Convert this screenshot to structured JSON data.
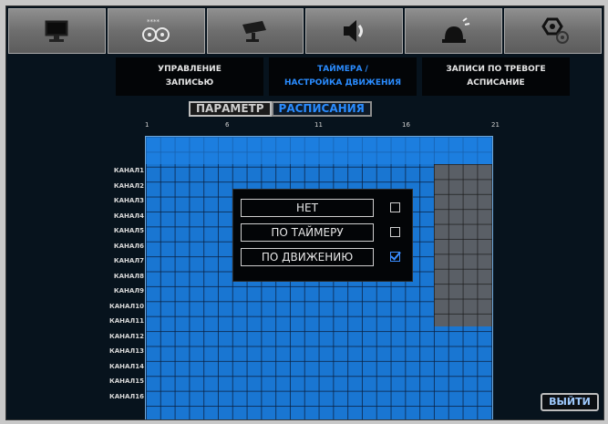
{
  "top_icons": [
    {
      "name": "monitor-icon"
    },
    {
      "name": "record-icon"
    },
    {
      "name": "camera-icon"
    },
    {
      "name": "speaker-icon"
    },
    {
      "name": "alarm-icon"
    },
    {
      "name": "settings-icon"
    }
  ],
  "submenu": [
    {
      "line1": "УПРАВЛЕНИЕ",
      "line2": "ЗАПИСЬЮ",
      "active": false
    },
    {
      "line1": "ТАЙМЕРА /",
      "line2": "НАСТРОЙКА ДВИЖЕНИЯ",
      "active": true
    },
    {
      "line1": "ЗАПИСИ ПО ТРЕВОГЕ",
      "line2": "АСПИСАНИЕ",
      "active": false
    }
  ],
  "tabs": [
    {
      "label": "ПАРАМЕТР",
      "active": false
    },
    {
      "label": "РАСПИСАНИЯ",
      "active": true
    }
  ],
  "ruler": [
    "1",
    "6",
    "11",
    "16",
    "21"
  ],
  "channels": [
    "КАНАЛ1",
    "КАНАЛ2",
    "КАНАЛ3",
    "КАНАЛ4",
    "КАНАЛ5",
    "КАНАЛ6",
    "КАНАЛ7",
    "КАНАЛ8",
    "КАНАЛ9",
    "КАНАЛ10",
    "КАНАЛ11",
    "КАНАЛ12",
    "КАНАЛ13",
    "КАНАЛ14",
    "КАНАЛ15",
    "КАНАЛ16"
  ],
  "popup": {
    "options": [
      {
        "label": "НЕТ",
        "checked": false
      },
      {
        "label": "ПО ТАЙМЕРУ",
        "checked": false
      },
      {
        "label": "ПО ДВИЖЕНИЮ",
        "checked": true
      }
    ]
  },
  "exit_label": "ВЫЙТИ",
  "colors": {
    "schedule_blue": "#1976d2",
    "accent": "#2a8cff",
    "background": "#07131d"
  }
}
